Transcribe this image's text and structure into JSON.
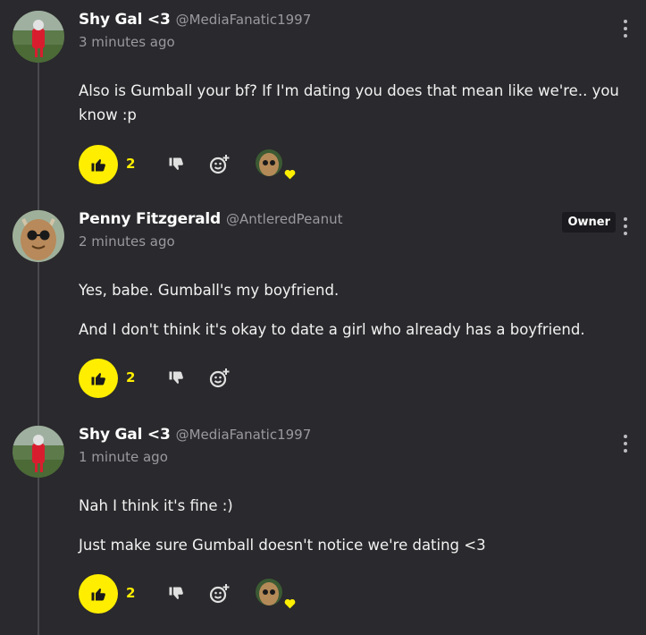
{
  "comments": [
    {
      "name": "Shy Gal <3",
      "handle": "@MediaFanatic1997",
      "time": "3 minutes ago",
      "owner": "",
      "paragraphs": [
        "Also is Gumball your bf? If I'm dating you does that mean like we're.. you know :p"
      ],
      "likes": "2",
      "avatar_icon": "shy-gal-avatar",
      "reaction_icon": "penny-heart-reaction"
    },
    {
      "name": "Penny Fitzgerald",
      "handle": "@AntleredPeanut",
      "time": "2 minutes ago",
      "owner": "Owner",
      "paragraphs": [
        "Yes, babe. Gumball's my boyfriend.",
        "And I don't think it's okay to date a girl who already has a boyfriend."
      ],
      "likes": "2",
      "avatar_icon": "penny-avatar",
      "reaction_icon": ""
    },
    {
      "name": "Shy Gal <3",
      "handle": "@MediaFanatic1997",
      "time": "1 minute ago",
      "owner": "",
      "paragraphs": [
        "Nah I think it's fine :)",
        "Just make sure Gumball doesn't notice we're dating <3"
      ],
      "likes": "2",
      "avatar_icon": "shy-gal-avatar",
      "reaction_icon": "penny-heart-reaction"
    }
  ],
  "colors": {
    "background": "#2a292d",
    "accent": "#ffee00",
    "muted_text": "#9a999e"
  }
}
